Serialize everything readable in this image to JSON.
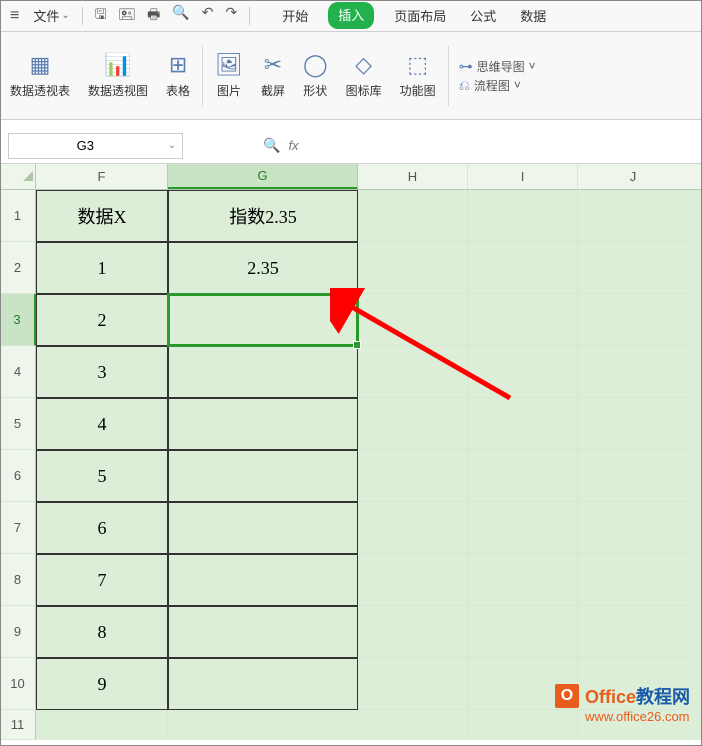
{
  "menubar": {
    "file": "文件"
  },
  "tabs": {
    "start": "开始",
    "insert": "插入",
    "pagelayout": "页面布局",
    "formula": "公式",
    "data": "数据"
  },
  "ribbon": {
    "pivottable": "数据透视表",
    "pivotchart": "数据透视图",
    "table": "表格",
    "picture": "图片",
    "screenshot": "截屏",
    "shapes": "形状",
    "iconlib": "图标库",
    "funcchart": "功能图",
    "mindmap": "思维导图",
    "flowchart": "流程图"
  },
  "namebox": "G3",
  "fx_label": "fx",
  "columns": {
    "F": "F",
    "G": "G",
    "H": "H",
    "I": "I",
    "J": "J"
  },
  "rows": [
    "1",
    "2",
    "3",
    "4",
    "5",
    "6",
    "7",
    "8",
    "9",
    "10",
    "11"
  ],
  "cells": {
    "F1": "数据X",
    "G1": "指数2.35",
    "F2": "1",
    "G2": "2.35",
    "F3": "2",
    "F4": "3",
    "F5": "4",
    "F6": "5",
    "F7": "6",
    "F8": "7",
    "F9": "8",
    "F10": "9"
  },
  "watermark": {
    "brand_o": "Office",
    "brand_rest": "教程网",
    "url": "www.office26.com"
  }
}
